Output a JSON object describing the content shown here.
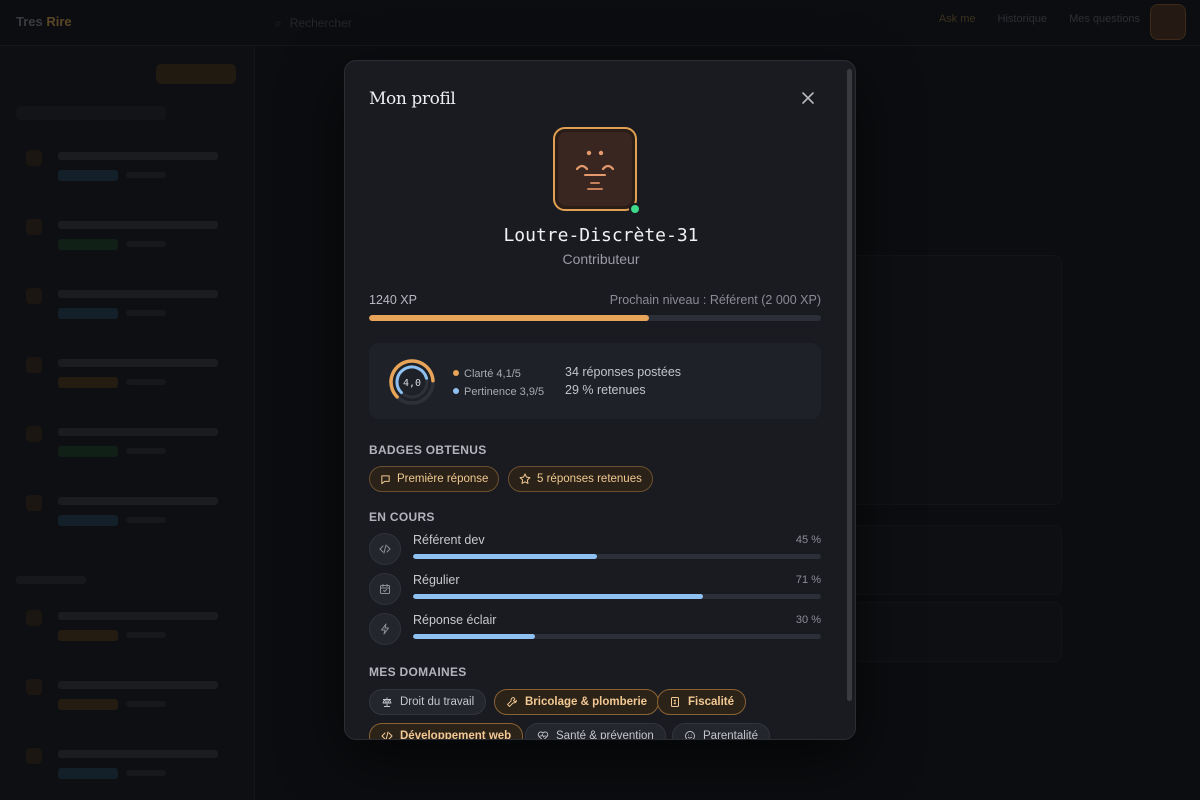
{
  "background": {
    "brand": "Tres",
    "brand_accent": "Rire",
    "search_placeholder": "Rechercher",
    "top_actions": [
      "Ask me",
      "Historique",
      "Mes questions"
    ]
  },
  "modal": {
    "title": "Mon profil",
    "user": {
      "name": "Loutre-Discrète-31",
      "role": "Contributeur",
      "online": true
    },
    "xp": {
      "current_label": "1240 XP",
      "next_label": "Prochain niveau : Référent (2 000 XP)",
      "progress": 0.62
    },
    "stats": {
      "score": "4,0",
      "score_value": 4.0,
      "score_max": 5,
      "clarity": "Clarté 4,1/5",
      "relevance": "Pertinence 3,9/5",
      "answers_posted": "34 réponses postées",
      "answers_retained": "29 % retenues"
    },
    "badges_title": "BADGES OBTENUS",
    "badges": [
      {
        "label": "Première réponse",
        "icon": "chat-bubble-icon"
      },
      {
        "label": "5 réponses retenues",
        "icon": "star-icon"
      }
    ],
    "progress_title": "EN COURS",
    "progress_items": [
      {
        "name": "Référent dev",
        "pct_label": "45 %",
        "value": 0.45,
        "icon": "code-icon"
      },
      {
        "name": "Régulier",
        "pct_label": "71 %",
        "value": 0.71,
        "icon": "calendar-check-icon"
      },
      {
        "name": "Réponse éclair",
        "pct_label": "30 %",
        "value": 0.3,
        "icon": "lightning-icon"
      }
    ],
    "domains_title": "MES DOMAINES",
    "domains": [
      {
        "label": "Droit du travail",
        "icon": "scale-icon",
        "selected": false
      },
      {
        "label": "Bricolage & plomberie",
        "icon": "wrench-icon",
        "selected": true
      },
      {
        "label": "Fiscalité",
        "icon": "receipt-icon",
        "selected": true
      },
      {
        "label": "Développement web",
        "icon": "code-icon",
        "selected": true
      },
      {
        "label": "Santé & prévention",
        "icon": "heart-pulse-icon",
        "selected": false
      },
      {
        "label": "Parentalité",
        "icon": "smile-icon",
        "selected": false
      }
    ]
  },
  "colors": {
    "accent": "#e8a458",
    "progress_blue": "#8ec1f2",
    "online": "#3fd98c",
    "clarity_dot": "#e8a458",
    "relevance_dot": "#8ec1f2"
  }
}
